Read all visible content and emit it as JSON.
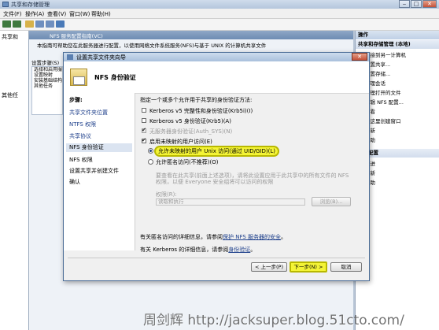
{
  "window": {
    "title": "共享和存储管理"
  },
  "menu": [
    "文件(F)",
    "操作(A)",
    "查看(V)",
    "窗口(W)",
    "帮助(H)"
  ],
  "tree": {
    "root": "共享和",
    "sub": [
      "其他任"
    ],
    "visible_label": "共享和存储管理 (本地)"
  },
  "middle": {
    "header": "NFS 服务配置指南(VC)",
    "banner": "本指南可帮助您在此服务器进行配置，以使用网络文件系统服务(NFS)与基于 UNIX 的计算机共享文件",
    "left_label": "设置步骤(S)",
    "left_items": [
      "选择和启用服务",
      "设置映射",
      "安装基础结构",
      "其他任务"
    ]
  },
  "actions": {
    "header1": "操作",
    "header2": "共享和存储管理 (本地)",
    "items": [
      "连接到另一计算机",
      "设置共享...",
      "设置存储...",
      "管理会话",
      "管理打开的文件",
      "编辑 NFS 配置...",
      "查看",
      "从这里创建窗口",
      "刷新",
      "帮助"
    ],
    "sub_items": [
      "服务配置",
      "改进",
      "刷新",
      "帮助"
    ]
  },
  "dialog": {
    "title": "设置共享文件夹向导",
    "heading": "NFS 身份验证",
    "steps_header": "步骤:",
    "steps": [
      "共享文件夹位置",
      "NTFS 权限",
      "共享协议",
      "NFS 身份验证",
      "NFS 权限",
      "设置共享并创建文件",
      "确认"
    ],
    "prompt": "指定一个或多个允许用于共享的身份验证方法:",
    "auth": [
      {
        "label": "Kerberos v5 完整性和身份验证(Krb5i)(I)",
        "checked": false,
        "disabled": false
      },
      {
        "label": "Kerberos v5 身份验证(Krb5)(A)",
        "checked": false,
        "disabled": false
      },
      {
        "label": "无服务器身份验证(Auth_SYS)(N)",
        "checked": true,
        "disabled": true
      }
    ],
    "unmapped": {
      "label": "启用未映射的用户访问(E)",
      "checked": true
    },
    "radio1": "允许未映射的用户 Unix 访问(通过 UID/GID)(L)",
    "radio2": "允许匿名访问(不推荐)(O)",
    "radio_selected": 0,
    "note": "要查看在此共享(前面上述选项)，请将此设置应用于此共享中的所有文件的 NFS 权限，以便 Everyone 安全组将可以访问的权限",
    "group_label": "权限(R):",
    "group_value": "读取和执行",
    "browse": "浏览(B)...",
    "info1_prefix": "有关匿名访问的详细信息，请参阅",
    "info1_link": "保护 NFS 服务器的安全",
    "info1_suffix": "。",
    "info2_prefix": "有关 Kerberos 的详细信息，请参阅",
    "info2_link": "身份验证",
    "info2_suffix": "。",
    "btn_back": "< 上一步(P)",
    "btn_next": "下一步(N) >",
    "btn_cancel": "取消"
  },
  "watermark": "周剑辉 http://jacksuper.blog.51cto.com/"
}
